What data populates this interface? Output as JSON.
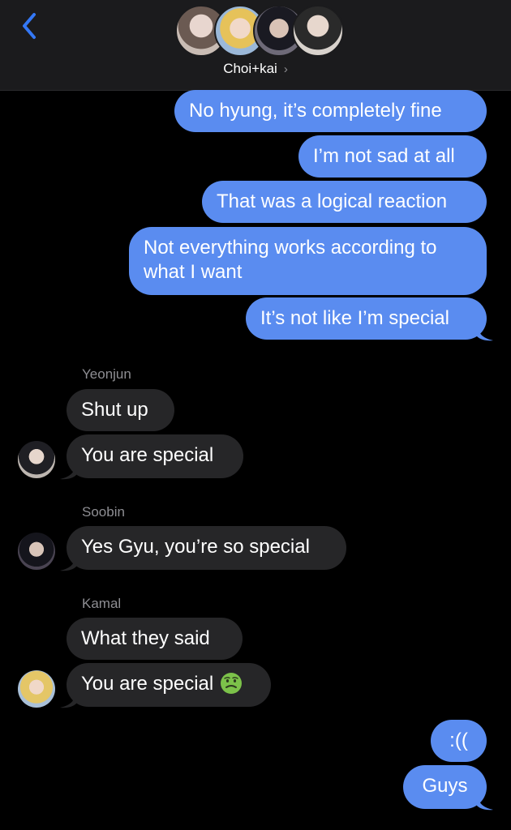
{
  "header": {
    "group_name": "Choi+kai",
    "chevron": "›",
    "back_icon": "chevron-left-icon",
    "accent": "#3478f6"
  },
  "colors": {
    "outgoing_bubble": "#5a8cf0",
    "incoming_bubble": "#262628",
    "background": "#000000"
  },
  "outgoing_top": [
    "No hyung, it’s completely fine",
    "I’m not sad at all",
    "That was a logical reaction",
    "Not everything works according to what I want",
    "It’s not like I’m special"
  ],
  "yeonjun": {
    "sender": "Yeonjun",
    "messages": [
      "Shut up",
      "You are special"
    ]
  },
  "soobin": {
    "sender": "Soobin",
    "messages": [
      "Yes Gyu, you’re so special"
    ]
  },
  "kamal": {
    "sender": "Kamal",
    "messages": [
      "What they said",
      "You are special"
    ],
    "emoji": "nauseated-face-emoji"
  },
  "outgoing_bottom": [
    ":((",
    "Guys"
  ]
}
